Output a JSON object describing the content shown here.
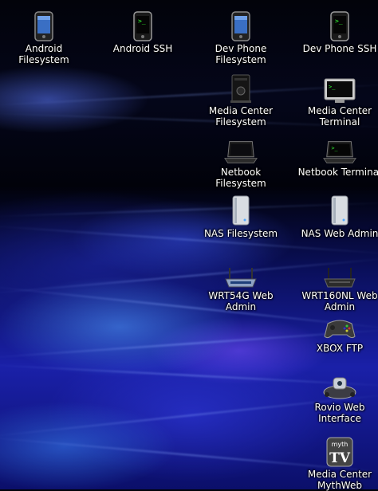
{
  "desktop": {
    "icons": [
      {
        "label": "Android Filesystem",
        "icon": "android-phone-icon"
      },
      {
        "label": "Android SSH",
        "icon": "terminal-phone-icon"
      },
      {
        "label": "Dev Phone Filesystem",
        "icon": "android-phone-icon"
      },
      {
        "label": "Dev Phone SSH",
        "icon": "terminal-phone-icon"
      },
      {
        "label": "Media Center Filesystem",
        "icon": "media-center-icon"
      },
      {
        "label": "Media Center Terminal",
        "icon": "terminal-screen-icon"
      },
      {
        "label": "Netbook Filesystem",
        "icon": "laptop-icon"
      },
      {
        "label": "Netbook Terminal",
        "icon": "laptop-terminal-icon"
      },
      {
        "label": "NAS Filesystem",
        "icon": "nas-drive-icon"
      },
      {
        "label": "NAS Web Admin",
        "icon": "nas-drive-icon"
      },
      {
        "label": "WRT54G Web Admin",
        "icon": "router-icon"
      },
      {
        "label": "WRT160NL Web Admin",
        "icon": "router-icon"
      },
      {
        "label": "XBOX FTP",
        "icon": "game-controller-icon"
      },
      {
        "label": "Rovio Web Interface",
        "icon": "robot-icon"
      },
      {
        "label": "Media Center MythWeb",
        "icon": "mythtv-icon"
      }
    ],
    "mythtv_badge": {
      "line1": "myth",
      "line2": "TV"
    }
  }
}
